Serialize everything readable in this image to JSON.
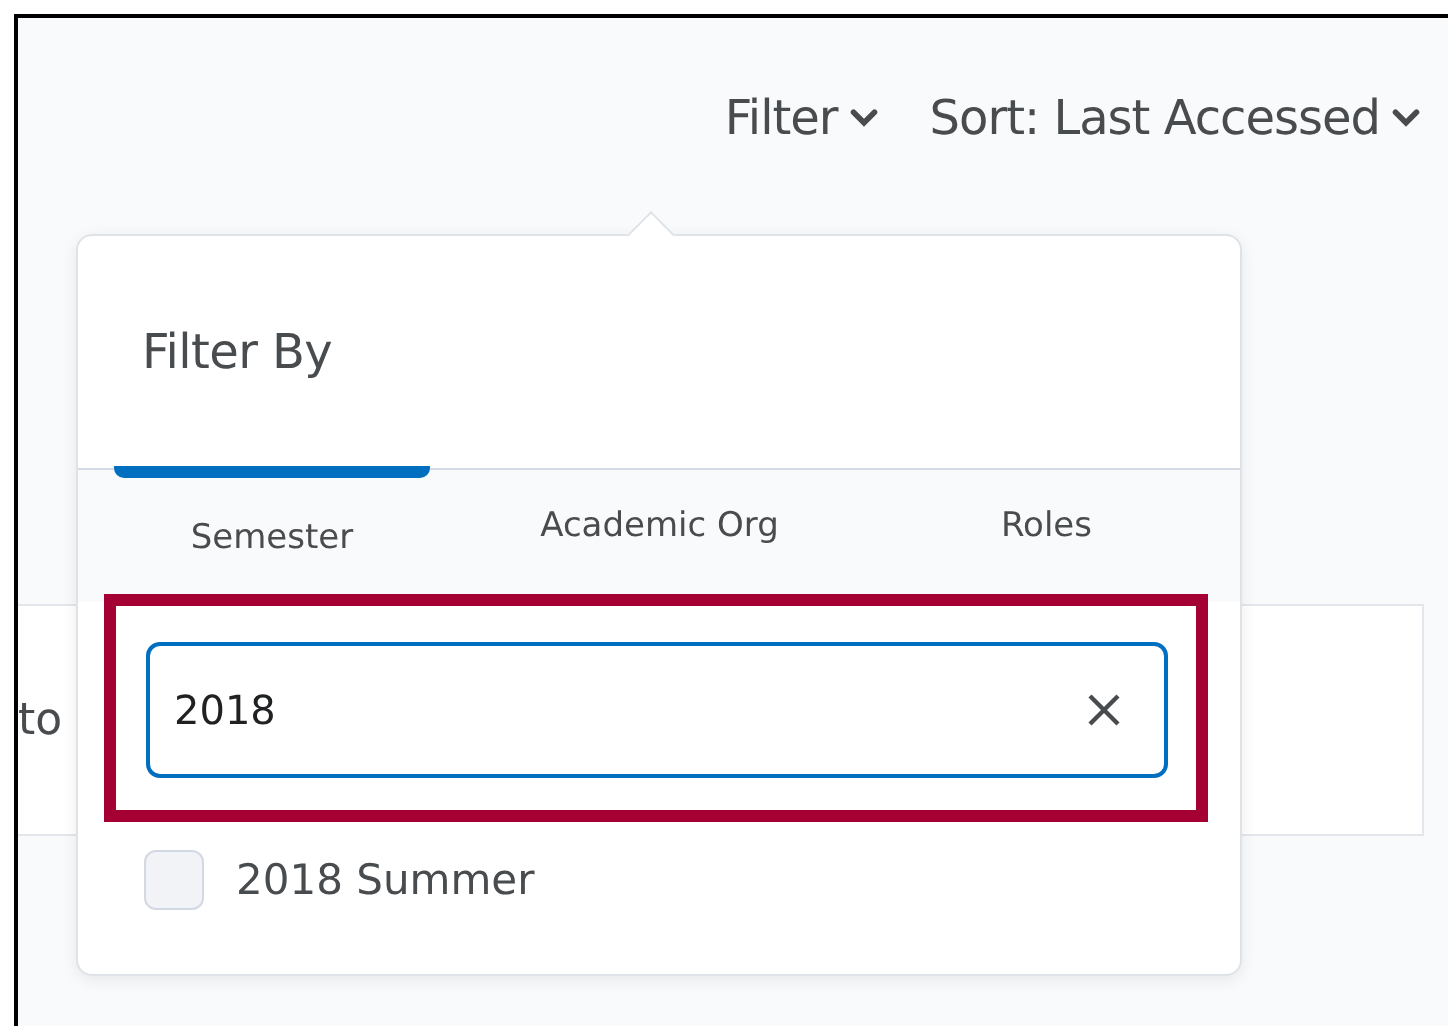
{
  "toolbar": {
    "filter": {
      "label": "Filter",
      "expanded": true
    },
    "sort": {
      "label": "Sort: Last Accessed"
    }
  },
  "background_card": {
    "text": "to"
  },
  "popup": {
    "title": "Filter By",
    "tabs": [
      {
        "label": "Semester",
        "selected": true
      },
      {
        "label": "Academic Org",
        "selected": false
      },
      {
        "label": "Roles",
        "selected": false
      }
    ],
    "search": {
      "value": "2018",
      "highlighted": true
    },
    "options": [
      {
        "label": "2018 Summer",
        "checked": false
      }
    ]
  }
}
